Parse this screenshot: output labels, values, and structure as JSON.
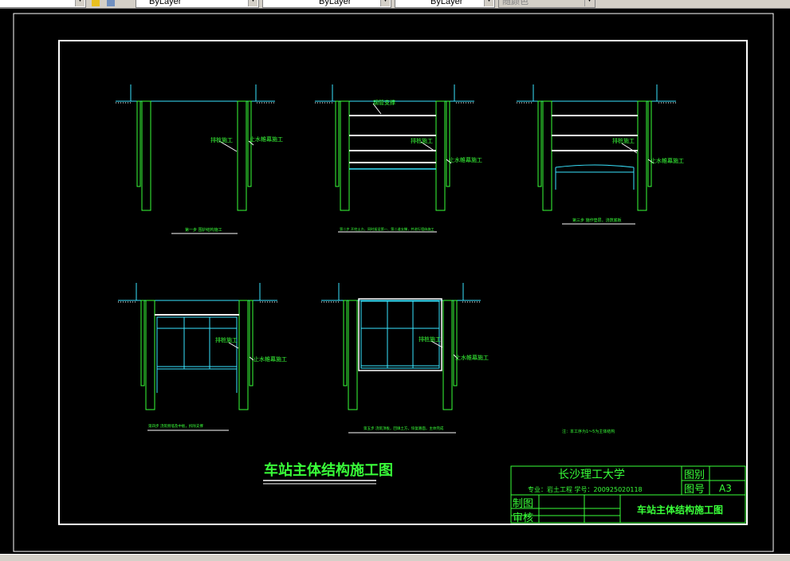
{
  "toolbar": {
    "linetype_value": "ByLayer",
    "lineweight_value": "ByLayer",
    "plotstyle_value": "ByLayer",
    "color_value": "随颜色",
    "icons": [
      "layer-states-icon",
      "layer-previous-icon"
    ]
  },
  "drawing": {
    "main_title": "车站主体结构施工图",
    "stages": [
      {
        "caption": "第一步 围护结构施工",
        "labels": [
          "排桩施工",
          "止水帷幕施工"
        ]
      },
      {
        "caption": "第二步 开挖土方，同时架设第一、第二道支撑，并进行墙体施工",
        "labels": [
          "钢管支撑",
          "排桩施工",
          "止水帷幕施工"
        ]
      },
      {
        "caption": "第三步 施作垫层，浇筑底板",
        "labels": [
          "排桩施工",
          "止水帷幕施工"
        ]
      },
      {
        "caption": "第四步 浇筑侧墙及中板，拆除支撑",
        "labels": [
          "排桩施工",
          "止水帷幕施工"
        ]
      },
      {
        "caption": "第五步 浇筑顶板，回填土方，恢复路面，主体完成",
        "labels": [
          "排桩施工",
          "止水帷幕施工"
        ]
      }
    ],
    "note": "注：本工序为1～5为主体结构",
    "title_block": {
      "school": "长沙理工大学",
      "category_label": "图别",
      "number_label": "图号",
      "size": "A3",
      "info": "专业：岩土工程  学号：200925020118",
      "drawn_label": "制图",
      "check_label": "审核",
      "drawing_name": "车站主体结构施工图"
    }
  },
  "colors": {
    "green": "#39ff39",
    "cyan": "#39e5ff",
    "white": "#ffffff"
  }
}
